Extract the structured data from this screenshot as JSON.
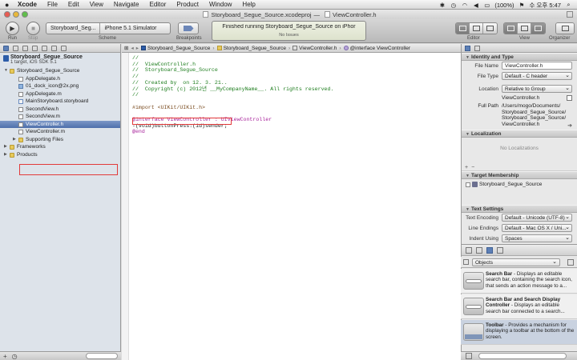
{
  "menubar": {
    "apple": "",
    "items": [
      "Xcode",
      "File",
      "Edit",
      "View",
      "Navigate",
      "Editor",
      "Product",
      "Window",
      "Help"
    ],
    "battery": "(100%)",
    "clock": "수 오후 5:47"
  },
  "window": {
    "title": "Storyboard_Segue_Source.xcodeproj",
    "separator": "—",
    "file": "ViewController.h"
  },
  "toolbar": {
    "run_label": "Run",
    "stop_label": "Stop",
    "scheme_target": "Storyboard_Seg...",
    "scheme_device": "iPhone 5.1 Simulator",
    "scheme_label": "Scheme",
    "breakpoints_label": "Breakpoints",
    "activity_status": "Finished running Storyboard_Segue_Source on iPhor",
    "activity_issues": "No Issues",
    "editor_label": "Editor",
    "view_label": "View",
    "organizer_label": "Organizer"
  },
  "navigator": {
    "project_name": "Storyboard_Segue_Source",
    "project_subtitle": "1 target, iOS SDK 5.1",
    "items": [
      {
        "label": "Storyboard_Segue_Source",
        "kind": "folder",
        "indent": 1,
        "open": true
      },
      {
        "label": "AppDelegate.h",
        "kind": "h",
        "indent": 2
      },
      {
        "label": "01_dock_icon@2x.png",
        "kind": "png",
        "indent": 2
      },
      {
        "label": "AppDelegate.m",
        "kind": "m",
        "indent": 2
      },
      {
        "label": "MainStoryboard.storyboard",
        "kind": "sb",
        "indent": 2
      },
      {
        "label": "SecondView.h",
        "kind": "h",
        "indent": 2
      },
      {
        "label": "SecondView.m",
        "kind": "m",
        "indent": 2
      },
      {
        "label": "ViewController.h",
        "kind": "h",
        "indent": 2,
        "selected": true
      },
      {
        "label": "ViewController.m",
        "kind": "m",
        "indent": 2
      },
      {
        "label": "Supporting Files",
        "kind": "folder",
        "indent": 2,
        "closed": true
      },
      {
        "label": "Frameworks",
        "kind": "folder",
        "indent": 1,
        "closed": true
      },
      {
        "label": "Products",
        "kind": "folder",
        "indent": 1,
        "closed": true
      }
    ]
  },
  "jumpbar": {
    "crumbs": [
      "Storyboard_Segue_Source",
      "Storyboard_Segue_Source",
      "ViewController.h",
      "@interface ViewController"
    ]
  },
  "code": {
    "lines": [
      {
        "cls": "cm",
        "text": "//"
      },
      {
        "cls": "cm",
        "text": "//  ViewController.h"
      },
      {
        "cls": "cm",
        "text": "//  Storyboard_Segue_Source"
      },
      {
        "cls": "cm",
        "text": "//"
      },
      {
        "cls": "cm",
        "text": "//  Created by  on 12. 3. 21.."
      },
      {
        "cls": "cm",
        "text": "//  Copyright (c) 2012년 __MyCompanyName__. All rights reserved."
      },
      {
        "cls": "cm",
        "text": "//"
      },
      {
        "cls": "",
        "text": ""
      },
      {
        "cls": "pp",
        "text": "#import <UIKit/UIKit.h>"
      },
      {
        "cls": "",
        "text": ""
      },
      {
        "cls": "kw",
        "text": "@interface ViewController : UIViewController"
      },
      {
        "cls": "",
        "text": "-(void)buttonPress:(id)sender;"
      },
      {
        "cls": "kw",
        "text": "@end"
      }
    ]
  },
  "inspector": {
    "identity_title": "Identity and Type",
    "file_name_label": "File Name",
    "file_name": "ViewController.h",
    "file_type_label": "File Type",
    "file_type": "Default - C header",
    "location_label": "Location",
    "location": "Relative to Group",
    "location_path": "ViewController.h",
    "full_path_label": "Full Path",
    "full_path": "/Users/mogo/Documents/\nStoryboard_Segue_Source/\nStoryboard_Segue_Source/\nViewController.h",
    "localization_title": "Localization",
    "no_localizations": "No Localizations",
    "target_membership_title": "Target Membership",
    "target_name": "Storyboard_Segue_Source",
    "text_settings_title": "Text Settings",
    "text_encoding_label": "Text Encoding",
    "text_encoding": "Default - Unicode (UTF-8)",
    "line_endings_label": "Line Endings",
    "line_endings": "Default - Mac OS X / Uni...",
    "indent_using_label": "Indent Using",
    "indent_using": "Spaces"
  },
  "library": {
    "selected": "Objects",
    "items": [
      {
        "title": "Search Bar",
        "desc": " - Displays an editable search bar, containing the search icon, that sends an action message to a..."
      },
      {
        "title": "Search Bar and Search Display Controller",
        "desc": " - Displays an editable search bar connected to a search..."
      },
      {
        "title": "Toolbar",
        "desc": " - Provides a mechanism for displaying a toolbar at the bottom of the screen."
      }
    ]
  }
}
